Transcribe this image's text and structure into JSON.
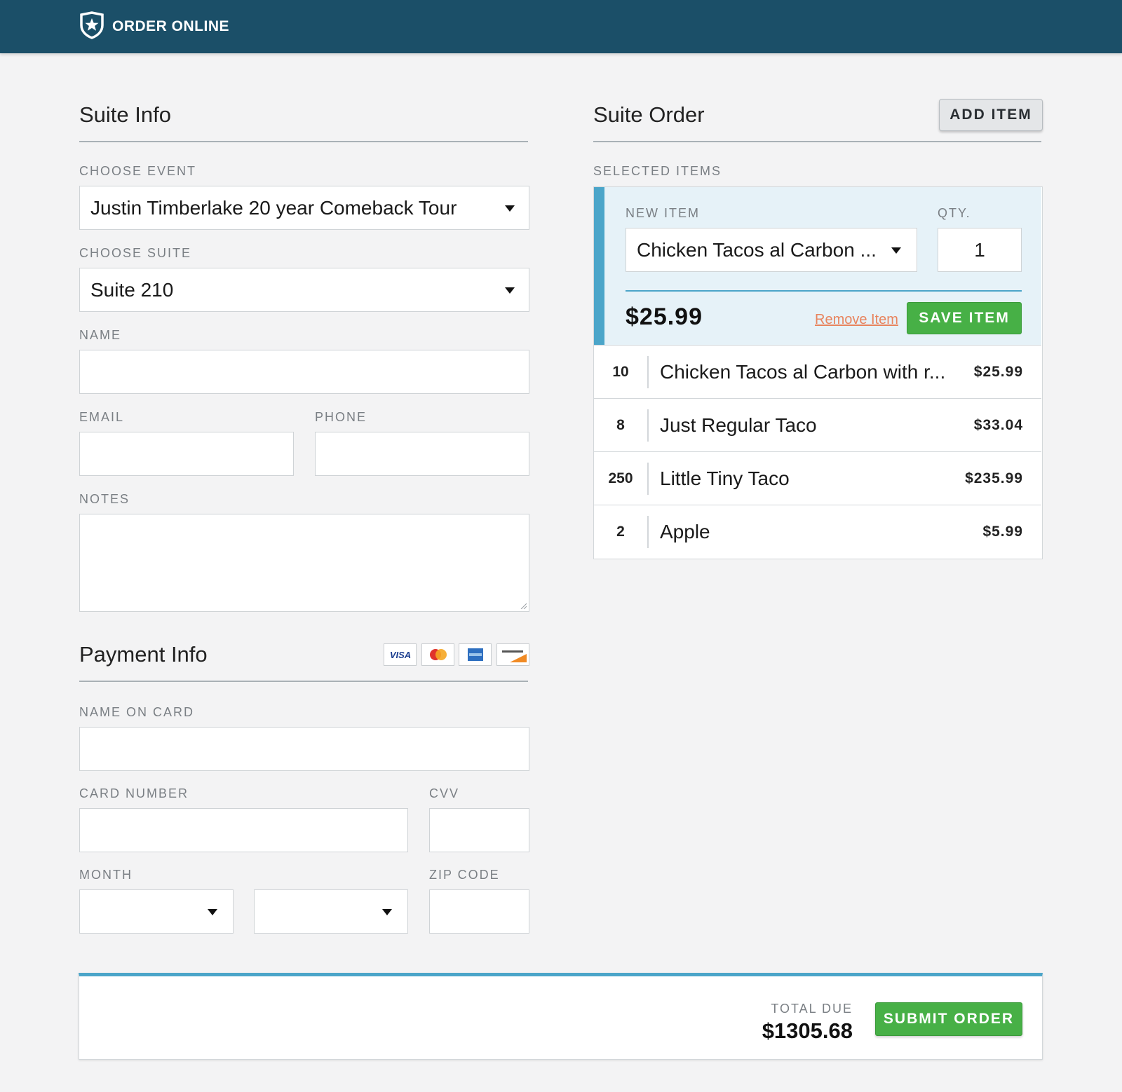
{
  "header": {
    "brand": "ORDER ONLINE",
    "brand_icon": "shield-star-icon"
  },
  "suite_info": {
    "title": "Suite Info",
    "choose_event": {
      "label": "CHOOSE EVENT",
      "value": "Justin Timberlake 20 year Comeback Tour"
    },
    "choose_suite": {
      "label": "CHOOSE SUITE",
      "value": "Suite 210"
    },
    "name": {
      "label": "NAME",
      "value": ""
    },
    "email": {
      "label": "EMAIL",
      "value": ""
    },
    "phone": {
      "label": "PHONE",
      "value": ""
    },
    "notes": {
      "label": "NOTES",
      "value": ""
    }
  },
  "payment_info": {
    "title": "Payment Info",
    "cards": [
      "VISA",
      "MasterCard",
      "American Express",
      "DISCOVER"
    ],
    "name_on_card": {
      "label": "NAME ON CARD",
      "value": ""
    },
    "card_number": {
      "label": "CARD NUMBER",
      "value": ""
    },
    "cvv": {
      "label": "CVV",
      "value": ""
    },
    "month": {
      "label": "MONTH",
      "value": ""
    },
    "year": {
      "value": ""
    },
    "zip_code": {
      "label": "ZIP CODE",
      "value": ""
    }
  },
  "suite_order": {
    "title": "Suite Order",
    "add_item_label": "ADD ITEM",
    "selected_items_label": "SELECTED ITEMS",
    "editor": {
      "new_item_label": "NEW ITEM",
      "new_item_value": "Chicken Tacos al Carbon ...",
      "qty_label": "QTY.",
      "qty_value": "1",
      "price": "$25.99",
      "remove_label": "Remove Item",
      "save_label": "SAVE ITEM"
    },
    "items": [
      {
        "qty": "10",
        "name": "Chicken Tacos al Carbon with r...",
        "price": "$25.99"
      },
      {
        "qty": "8",
        "name": "Just Regular Taco",
        "price": "$33.04"
      },
      {
        "qty": "250",
        "name": "Little Tiny Taco",
        "price": "$235.99"
      },
      {
        "qty": "2",
        "name": "Apple",
        "price": "$5.99"
      }
    ]
  },
  "footer": {
    "total_label": "TOTAL DUE",
    "total_value": "$1305.68",
    "submit_label": "SUBMIT ORDER"
  },
  "colors": {
    "header_bg": "#1b4f68",
    "accent_blue": "#4ba5c9",
    "green": "#47b046",
    "remove_link": "#e8845e"
  }
}
